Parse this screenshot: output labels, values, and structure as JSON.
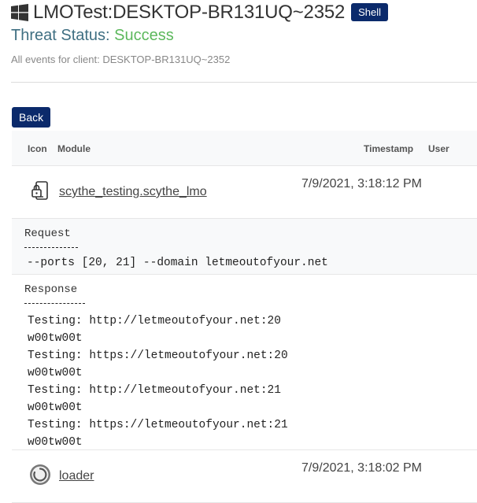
{
  "header": {
    "title": "LMOTest:DESKTOP-BR131UQ~2352",
    "badge": "Shell",
    "status_label": "Threat Status: ",
    "status_value": "Success",
    "subtitle": "All events for client: DESKTOP-BR131UQ~2352"
  },
  "back_label": "Back",
  "table": {
    "columns": {
      "icon": "Icon",
      "module": "Module",
      "timestamp": "Timestamp",
      "user": "User"
    },
    "rows": [
      {
        "module": "scythe_testing.scythe_lmo",
        "timestamp": "7/9/2021, 3:18:12 PM",
        "icon": "lock-phone-icon"
      },
      {
        "module": "loader",
        "timestamp": "7/9/2021, 3:18:02 PM",
        "icon": "loader-circle-icon"
      }
    ],
    "request": {
      "label": "Request",
      "content": "--ports [20, 21] --domain letmeoutofyour.net"
    },
    "response": {
      "label": "Response",
      "lines": [
        "Testing: http://letmeoutofyour.net:20",
        "w00tw00t",
        "Testing: https://letmeoutofyour.net:20",
        "w00tw00t",
        "Testing: http://letmeoutofyour.net:21",
        "w00tw00t",
        "Testing: https://letmeoutofyour.net:21",
        "w00tw00t"
      ]
    }
  },
  "colors": {
    "primary": "#0b2a6b",
    "success": "#5cb85c",
    "status_label": "#3f6f82"
  }
}
